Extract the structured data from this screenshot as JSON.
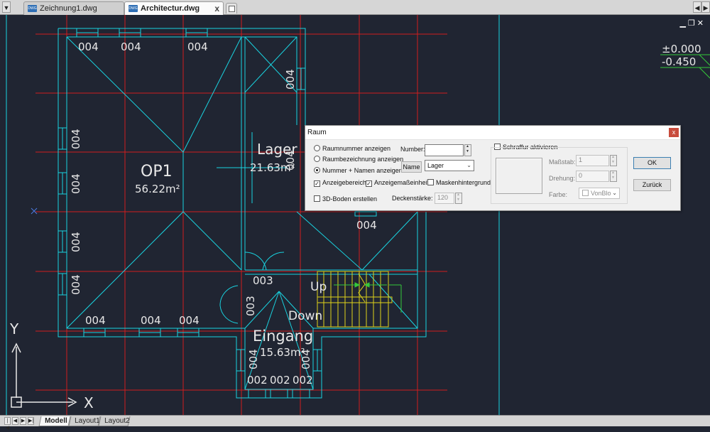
{
  "tabs": {
    "items": [
      {
        "label": "Zeichnung1.dwg",
        "icon": "dwg-file-icon"
      },
      {
        "label": "Architectur.dwg",
        "icon": "dwg-file-icon",
        "close": "x"
      }
    ]
  },
  "drawing": {
    "elevation_labels": [
      "±0.000",
      "-0.450"
    ],
    "rooms": [
      {
        "name": "OP1",
        "area": "56.22m²"
      },
      {
        "name": "Lager",
        "area": "21.63m²"
      },
      {
        "name": "Eingang",
        "area": "15.63m²"
      }
    ],
    "window_tags": {
      "top": [
        "004",
        "004",
        "004"
      ],
      "left": [
        "004",
        "004",
        "004",
        "004"
      ],
      "bottom": [
        "004",
        "004",
        "004"
      ],
      "lager_right": [
        "004",
        "004"
      ],
      "lager_bottom": "004",
      "door": "003",
      "stair_door": "003",
      "entrance_sides": [
        "004",
        "004"
      ],
      "entrance_bottom": [
        "002",
        "002",
        "002"
      ]
    },
    "stair_labels": {
      "up": "Up",
      "down": "Down"
    },
    "ucs_labels": {
      "x": "X",
      "y": "Y"
    },
    "colors": {
      "background": "#202532",
      "grid": "#d11d1d",
      "walls": "#19d3e0",
      "stair": "#e0d21a",
      "arrow": "#35c93a",
      "text": "#e8e8e8"
    }
  },
  "layout_tabs": [
    "Modell",
    "Layout1",
    "Layout2"
  ],
  "dialog": {
    "title": "Raum",
    "radio_options": [
      "Raumnummer anzeigen",
      "Raumbezeichnung anzeigen",
      "Nummer + Namen anzeigen"
    ],
    "number_label": "Number:",
    "number_value": "",
    "name_button": "Name",
    "name_value": "Lager",
    "checkbox_area": "Anzeigebereich",
    "checkbox_unit": "Anzeigemaßeinheit",
    "checkbox_mask": "Maskenhintergrund",
    "checkbox_3d": "3D-Boden erstellen",
    "slab_label": "Deckenstärke:",
    "slab_value": "120",
    "hatch_checkbox": "Schraffur aktivieren",
    "scale_label": "Maßstab:",
    "scale_value": "1",
    "rotation_label": "Drehung:",
    "rotation_value": "0",
    "color_label": "Farbe:",
    "color_value": "VonBlo",
    "ok_button": "OK",
    "back_button": "Zurück"
  }
}
